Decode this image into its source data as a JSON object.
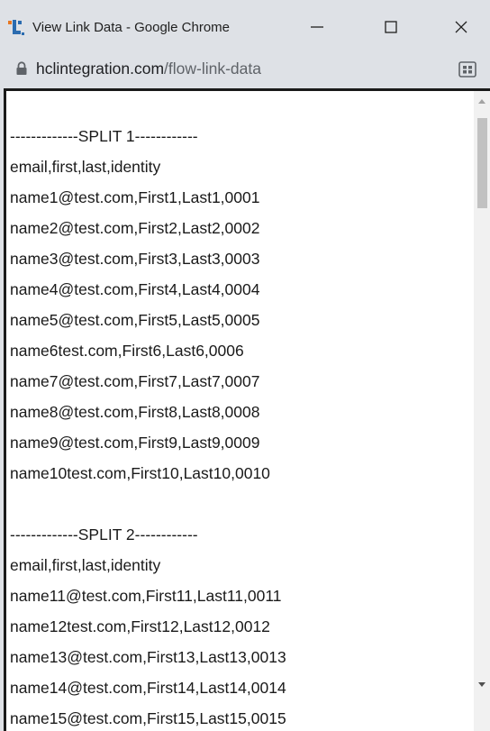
{
  "window": {
    "title": "View Link Data - Google Chrome"
  },
  "address_bar": {
    "host": "hclintegration.com",
    "path": "/flow-link-data"
  },
  "icons": {
    "app_logo": "app-logo-icon",
    "minimize": "minimize-icon",
    "maximize": "maximize-icon",
    "close": "close-icon",
    "lock": "lock-icon",
    "extension": "extension-icon",
    "scroll_up": "chevron-up-icon",
    "scroll_down": "chevron-down-icon"
  },
  "colors": {
    "titlebar_bg": "#dee1e6",
    "logo_blue": "#2b6cb0",
    "logo_orange": "#e87722",
    "text": "#1a1a1a"
  },
  "content": {
    "lines": [
      "-------------SPLIT 1------------",
      "email,first,last,identity",
      "name1@test.com,First1,Last1,0001",
      "name2@test.com,First2,Last2,0002",
      "name3@test.com,First3,Last3,0003",
      "name4@test.com,First4,Last4,0004",
      "name5@test.com,First5,Last5,0005",
      "name6test.com,First6,Last6,0006",
      "name7@test.com,First7,Last7,0007",
      "name8@test.com,First8,Last8,0008",
      "name9@test.com,First9,Last9,0009",
      "name10test.com,First10,Last10,0010",
      "",
      "-------------SPLIT 2------------",
      "email,first,last,identity",
      "name11@test.com,First11,Last11,0011",
      "name12test.com,First12,Last12,0012",
      "name13@test.com,First13,Last13,0013",
      "name14@test.com,First14,Last14,0014",
      "name15@test.com,First15,Last15,0015"
    ]
  }
}
